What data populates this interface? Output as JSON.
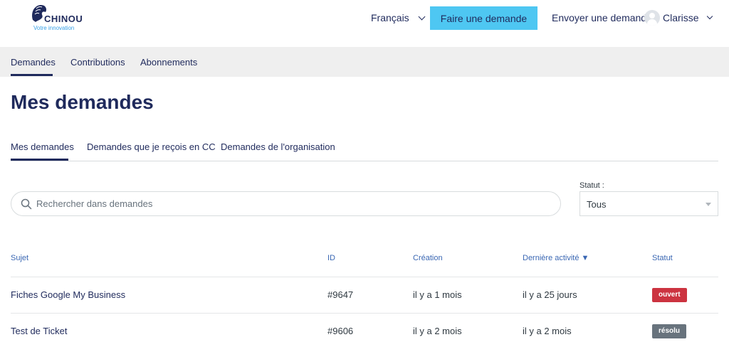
{
  "header": {
    "logo_word": "CHINOU",
    "logo_tagline": "Votre innovation",
    "language": "Français",
    "cta_label": "Faire une demande",
    "send_label": "Envoyer une demande",
    "user_name": "Clarisse"
  },
  "topnav": {
    "items": [
      "Demandes",
      "Contributions",
      "Abonnements"
    ],
    "active": "Demandes"
  },
  "page_title": "Mes demandes",
  "subtabs": {
    "items": [
      "Mes demandes",
      "Demandes que je reçois en CC",
      "Demandes de l'organisation"
    ],
    "active": "Mes demandes"
  },
  "search": {
    "placeholder": "Rechercher dans demandes"
  },
  "status_filter": {
    "label": "Statut :",
    "value": "Tous"
  },
  "table": {
    "headers": {
      "subject": "Sujet",
      "id": "ID",
      "created": "Création",
      "last_activity": "Dernière activité ▼",
      "status": "Statut"
    },
    "rows": [
      {
        "subject": "Fiches Google My Business",
        "id": "#9647",
        "created": "il y a 1 mois",
        "last_activity": "il y a 25 jours",
        "status": "ouvert",
        "status_color": "#cc3340"
      },
      {
        "subject": "Test de Ticket",
        "id": "#9606",
        "created": "il y a 2 mois",
        "last_activity": "il y a 2 mois",
        "status": "résolu",
        "status_color": "#68737d"
      }
    ]
  },
  "colors": {
    "primary": "#1f2a5c",
    "accent": "#4ec7f2",
    "link": "#3a67b3"
  }
}
